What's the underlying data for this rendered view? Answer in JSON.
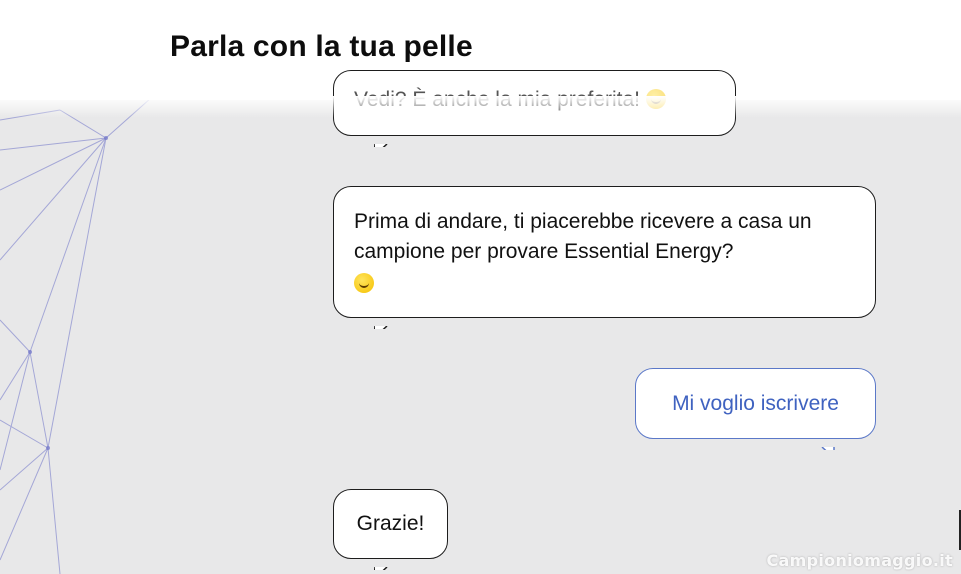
{
  "header": {
    "title": "Parla con la tua pelle"
  },
  "chat": {
    "messages": [
      {
        "sender": "bot",
        "text": "Vedi? È anche la mia preferita!",
        "emoji": "smile-emoji",
        "state": "partially-hidden"
      },
      {
        "sender": "bot",
        "text": "Prima di andare, ti piacerebbe ricevere a casa un campione per provare Essential Energy?",
        "emoji": "smile-emoji"
      },
      {
        "sender": "user",
        "text": "Mi voglio iscrivere"
      },
      {
        "sender": "bot",
        "text": "Grazie!"
      }
    ]
  },
  "watermark": "Campioniomaggio.it",
  "colors": {
    "background": "#e8e8e9",
    "header": "#ffffff",
    "user_bubble_text": "#3f62c0",
    "user_bubble_border": "#5b78c8",
    "network_lines": "#6d72c8"
  }
}
